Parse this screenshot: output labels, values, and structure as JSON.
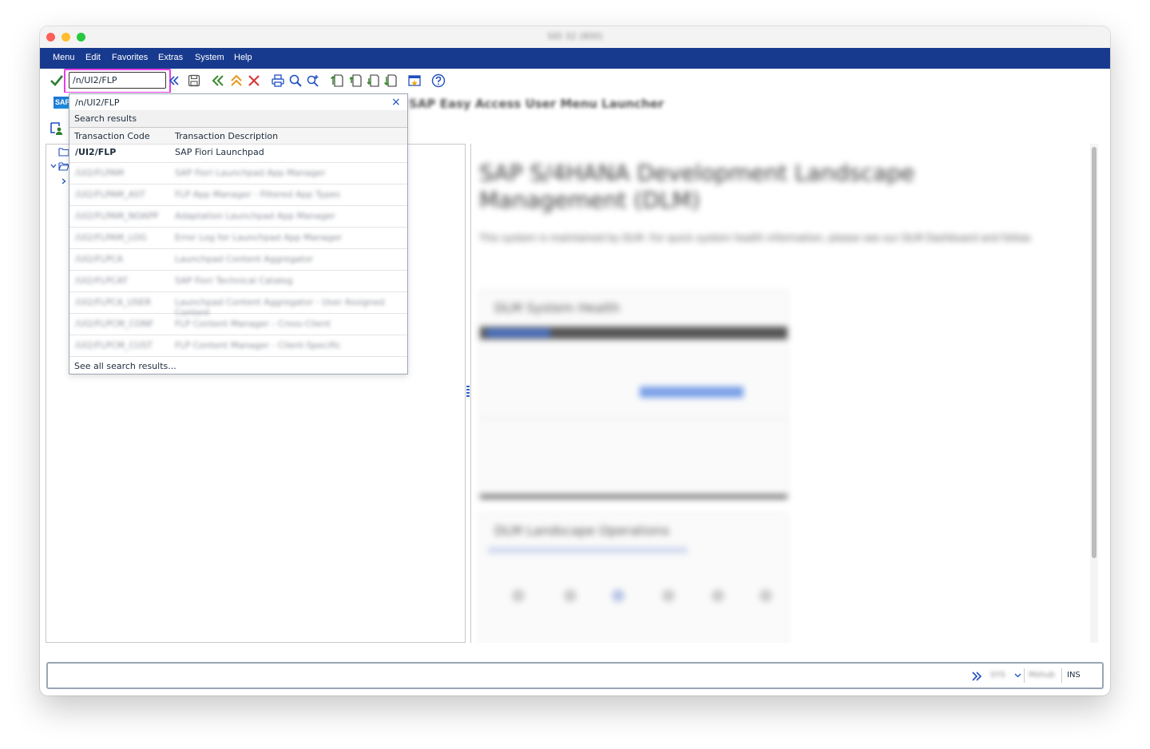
{
  "window": {
    "title": "SID 32 (800)"
  },
  "menubar": {
    "items": [
      "Menu",
      "Edit",
      "Favorites",
      "Extras",
      "System",
      "Help"
    ]
  },
  "toolbar": {
    "command_field_value": "/n/UI2/FLP",
    "icons": [
      "enter-checkmark-icon",
      "expand-history-icon",
      "save-icon",
      "back-icon",
      "exit-icon",
      "cancel-icon",
      "print-icon",
      "find-icon",
      "find-next-icon",
      "first-page-icon",
      "previous-page-icon",
      "next-page-icon",
      "last-page-icon",
      "customize-layout-icon",
      "help-icon"
    ]
  },
  "subheader": {
    "page_title": "SAP Easy Access User Menu Launcher"
  },
  "dropdown": {
    "query": "/n/UI2/FLP",
    "close_glyph": "×",
    "section_label": "Search results",
    "col_code": "Transaction Code",
    "col_description": "Transaction Description",
    "results": [
      {
        "code": "/UI2/FLP",
        "description": "SAP Fiori Launchpad",
        "bold": true,
        "blurred": false
      },
      {
        "code": "/UI2/FLPAM",
        "description": "SAP Fiori Launchpad App Manager",
        "bold": false,
        "blurred": true
      },
      {
        "code": "/UI2/FLPAM_AST",
        "description": "FLP App Manager - Filtered App Types",
        "bold": false,
        "blurred": true
      },
      {
        "code": "/UI2/FLPAM_NOAPP",
        "description": "Adaptation Launchpad App Manager",
        "bold": false,
        "blurred": true
      },
      {
        "code": "/UI2/FLPAM_LOG",
        "description": "Error Log for Launchpad App Manager",
        "bold": false,
        "blurred": true
      },
      {
        "code": "/UI2/FLPCA",
        "description": "Launchpad Content Aggregator",
        "bold": false,
        "blurred": true
      },
      {
        "code": "/UI2/FLPCAT",
        "description": "SAP Fiori Technical Catalog",
        "bold": false,
        "blurred": true
      },
      {
        "code": "/UI2/FLPCA_USER",
        "description": "Launchpad Content Aggregator - User Assigned Content",
        "bold": false,
        "blurred": true
      },
      {
        "code": "/UI2/FLPCM_CONF",
        "description": "FLP Content Manager - Cross-Client",
        "bold": false,
        "blurred": true
      },
      {
        "code": "/UI2/FLPCM_CUST",
        "description": "FLP Content Manager - Client-Specific",
        "bold": false,
        "blurred": true
      }
    ],
    "see_all_label": "See all search results..."
  },
  "content": {
    "heading": "SAP S/4HANA Development Landscape Management (DLM)",
    "paragraph": "This system is maintained by DLM. For quick system health information, please see our DLM Dashboard and follow.",
    "card1_title": "DLM System Health",
    "card2_title": "DLM Landscape Operations"
  },
  "statusbar": {
    "system_id": "SYS",
    "server": "Mshub",
    "mode": "INS"
  }
}
